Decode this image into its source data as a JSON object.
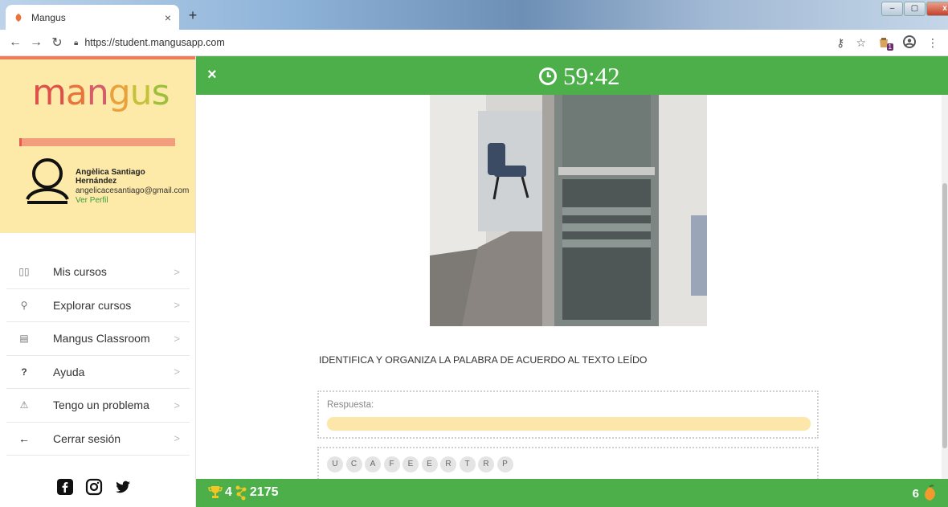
{
  "browser": {
    "tab_title": "Mangus",
    "tab_close": "×",
    "new_tab": "+",
    "url": "https://student.mangusapp.com",
    "extension_badge": "1",
    "window_controls": [
      "–",
      "▢",
      "x"
    ]
  },
  "sidebar": {
    "logo_text": "mangus",
    "user": {
      "name": "Angèlica Santiago Hernández",
      "email": "angelicacesantiago@gmail.com",
      "profile_link": "Ver Perfil"
    },
    "menu": [
      {
        "label": "Mis cursos",
        "icon": "book-icon",
        "glyph": "▯▯"
      },
      {
        "label": "Explorar cursos",
        "icon": "search-icon",
        "glyph": "⚲"
      },
      {
        "label": "Mangus Classroom",
        "icon": "classroom-icon",
        "glyph": "▤"
      },
      {
        "label": "Ayuda",
        "icon": "help-icon",
        "glyph": "?"
      },
      {
        "label": "Tengo un problema",
        "icon": "warning-icon",
        "glyph": "⚠"
      },
      {
        "label": "Cerrar sesión",
        "icon": "logout-icon",
        "glyph": "←"
      }
    ],
    "chevron": ">",
    "social": [
      "facebook-icon",
      "instagram-icon",
      "twitter-icon"
    ]
  },
  "quiz": {
    "close": "×",
    "timer": "59:42",
    "question": "IDENTIFICA Y ORGANIZA LA PALABRA DE ACUERDO AL TEXTO LEÍDO",
    "answer_label": "Respuesta:",
    "letters": [
      "U",
      "C",
      "A",
      "F",
      "E",
      "E",
      "R",
      "T",
      "R",
      "P"
    ]
  },
  "footer": {
    "trophies": "4",
    "points": "2175",
    "mangos": "6"
  },
  "colors": {
    "accent_green": "#4caf4a",
    "profile_bg": "#fde9a8",
    "answer_field": "#fde6a9"
  }
}
